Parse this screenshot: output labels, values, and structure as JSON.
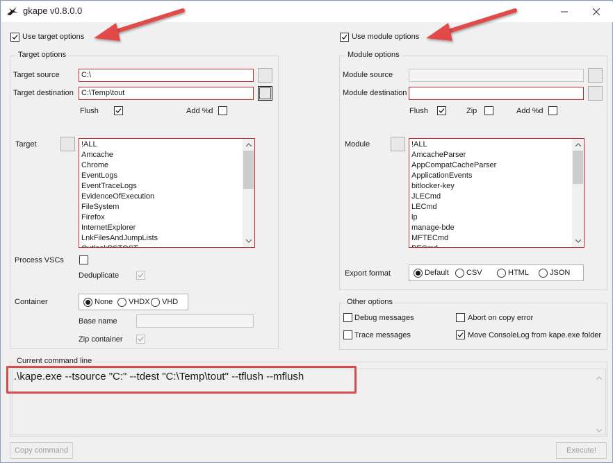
{
  "window": {
    "title": "gkape v0.8.0.0"
  },
  "left": {
    "use_target_label": "Use target options",
    "group_title": "Target options",
    "target_source_label": "Target source",
    "target_source_value": "C:\\",
    "target_destination_label": "Target destination",
    "target_destination_value": "C:\\Temp\\tout",
    "flush_label": "Flush",
    "add_d_label": "Add %d",
    "target_label": "Target",
    "targets": [
      "!ALL",
      "Amcache",
      "Chrome",
      "EventLogs",
      "EventTraceLogs",
      "EvidenceOfExecution",
      "FileSystem",
      "Firefox",
      "InternetExplorer",
      "LnkFilesAndJumpLists",
      "OutlookPSTOST"
    ],
    "process_vscs_label": "Process VSCs",
    "deduplicate_label": "Deduplicate",
    "container_label": "Container",
    "container_options": [
      "None",
      "VHDX",
      "VHD"
    ],
    "base_name_label": "Base name",
    "zip_container_label": "Zip container"
  },
  "right": {
    "use_module_label": "Use module options",
    "group_title": "Module options",
    "module_source_label": "Module source",
    "module_destination_label": "Module destination",
    "flush_label": "Flush",
    "zip_label": "Zip",
    "add_d_label": "Add %d",
    "module_label": "Module",
    "modules": [
      "!ALL",
      "AmcacheParser",
      "AppCompatCacheParser",
      "ApplicationEvents",
      "bitlocker-key",
      "JLECmd",
      "LECmd",
      "lp",
      "manage-bde",
      "MFTECmd",
      "PECmd"
    ],
    "export_format_label": "Export format",
    "export_options": [
      "Default",
      "CSV",
      "HTML",
      "JSON"
    ],
    "other_group_title": "Other options",
    "debug_messages_label": "Debug messages",
    "abort_on_copy_label": "Abort on copy error",
    "trace_messages_label": "Trace messages",
    "move_consolelog_label": "Move ConsoleLog from kape.exe folder"
  },
  "command": {
    "group_title": "Current command line",
    "text": ".\\kape.exe --tsource \"C:\" --tdest \"C:\\Temp\\tout\" --tflush --mflush"
  },
  "footer": {
    "copy_label": "Copy command",
    "execute_label": "Execute!"
  },
  "colors": {
    "highlight": "#d94a4a",
    "field_border": "#c72b2b"
  }
}
